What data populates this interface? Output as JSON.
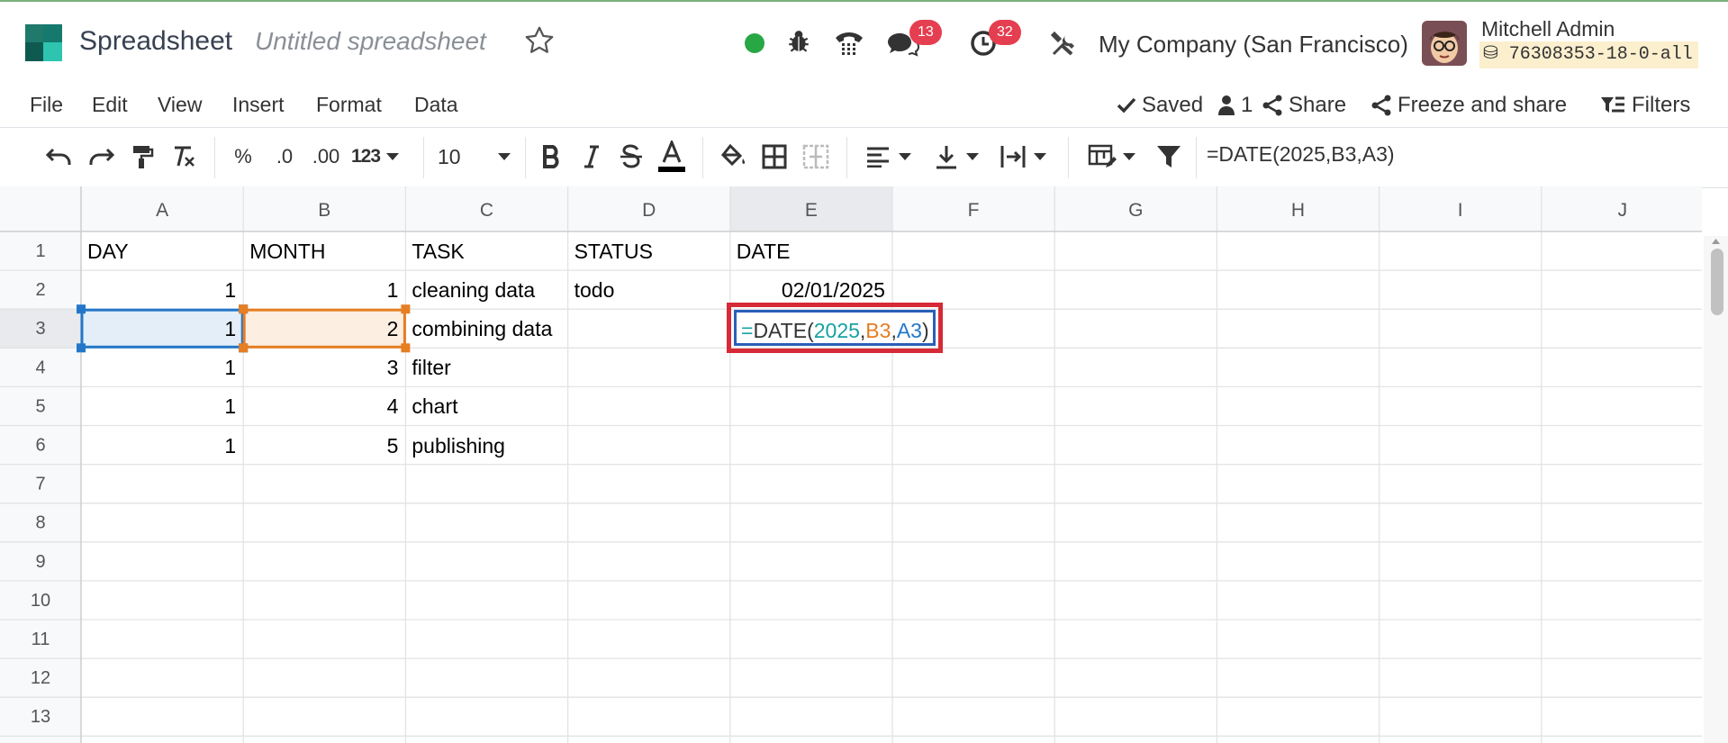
{
  "navbar": {
    "app_name": "Spreadsheet",
    "doc_name": "Untitled spreadsheet",
    "messages_count": "13",
    "activities_count": "32",
    "company": "My Company (San Francisco)",
    "user_name": "Mitchell Admin",
    "database": "76308353-18-0-all",
    "status_color": "#28a745"
  },
  "menu": {
    "items": [
      "File",
      "Edit",
      "View",
      "Insert",
      "Format",
      "Data"
    ],
    "saved_label": "Saved",
    "collaborators": "1",
    "share_label": "Share",
    "freeze_label": "Freeze and share",
    "filters_label": "Filters"
  },
  "toolbar": {
    "percent": "%",
    "decrease_decimals": ".0",
    "increase_decimals": ".00",
    "number_format": "123",
    "font_size": "10",
    "formula": "=DATE(2025,B3,A3)"
  },
  "grid": {
    "columns": [
      "A",
      "B",
      "C",
      "D",
      "E",
      "F",
      "G",
      "H",
      "I",
      "J"
    ],
    "rows": [
      "1",
      "2",
      "3",
      "4",
      "5",
      "6",
      "7",
      "8",
      "9",
      "10",
      "11",
      "12",
      "13"
    ],
    "headers": [
      "DAY",
      "MONTH",
      "TASK",
      "STATUS",
      "DATE"
    ],
    "data": [
      {
        "day": "1",
        "month": "1",
        "task": "cleaning data",
        "status": "todo",
        "date": "02/01/2025"
      },
      {
        "day": "1",
        "month": "2",
        "task": "combining data",
        "status": "",
        "date": ""
      },
      {
        "day": "1",
        "month": "3",
        "task": "filter",
        "status": "",
        "date": ""
      },
      {
        "day": "1",
        "month": "4",
        "task": "chart",
        "status": "",
        "date": ""
      },
      {
        "day": "1",
        "month": "5",
        "task": "publishing",
        "status": "",
        "date": ""
      }
    ],
    "selected_cell": "E3"
  },
  "editor": {
    "eq": "=",
    "fn": "DATE(",
    "arg1": "2025",
    "comma1": ",",
    "arg2": "B3",
    "comma2": ",",
    "arg3": "A3",
    "close": ")",
    "colors": {
      "number": "#17a2a2",
      "ref_b": "#e67e22",
      "ref_a": "#2477c8",
      "eq": "#17a2a2"
    }
  }
}
